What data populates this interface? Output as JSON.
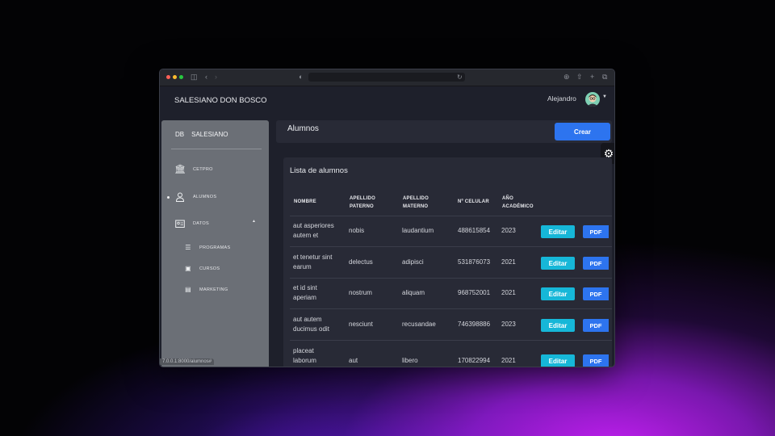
{
  "colors": {
    "accent_blue": "#2d74ef",
    "accent_cyan": "#16b7d8",
    "sidebar_bg": "#6b6f76",
    "card_bg": "#282a36",
    "window_bg": "#1e202b"
  },
  "browser": {
    "url": "",
    "icons": [
      "sidebar-toggle-icon",
      "back-icon",
      "forward-icon",
      "shield-icon",
      "reload-icon",
      "download-icon",
      "share-icon",
      "new-tab-icon",
      "tabs-icon"
    ]
  },
  "topbar": {
    "brand": "SALESIANO DON BOSCO",
    "user_name": "Alejandro"
  },
  "sidebar": {
    "brand_short": "DB",
    "brand_name": "SALESIANO",
    "items": [
      {
        "label": "CETPRO",
        "icon": "bank-icon"
      },
      {
        "label": "ALUMNOS",
        "icon": "user-icon"
      },
      {
        "label": "DATOS",
        "icon": "id-card-icon"
      }
    ],
    "sub_items": [
      {
        "label": "PROGRAMAS",
        "icon": "list-icon"
      },
      {
        "label": "CURSOS",
        "icon": "book-icon"
      },
      {
        "label": "MARKETING",
        "icon": "document-icon"
      }
    ]
  },
  "status_url": "7.0.0.1:8000/alumnos#",
  "page": {
    "title": "Alumnos",
    "create_label": "Crear"
  },
  "list": {
    "title": "Lista de alumnos",
    "headers": {
      "nombre": "NOMBRE",
      "paterno_1": "APELLIDO",
      "paterno_2": "PATERNO",
      "materno_1": "APELLIDO",
      "materno_2": "MATERNO",
      "celular": "Nº CELULAR",
      "anio_1": "AÑO",
      "anio_2": "ACADÉMICO"
    },
    "edit_label": "Editar",
    "pdf_label": "PDF",
    "rows": [
      {
        "nombre_1": "aut asperiores",
        "nombre_2": "autem et",
        "paterno": "nobis",
        "materno": "laudantium",
        "celular": "488615854",
        "anio": "2023"
      },
      {
        "nombre_1": "et tenetur sint",
        "nombre_2": "earum",
        "paterno": "delectus",
        "materno": "adipisci",
        "celular": "531876073",
        "anio": "2021"
      },
      {
        "nombre_1": "et id sint",
        "nombre_2": "aperiam",
        "paterno": "nostrum",
        "materno": "aliquam",
        "celular": "968752001",
        "anio": "2021"
      },
      {
        "nombre_1": "aut autem",
        "nombre_2": "ducimus odit",
        "paterno": "nesciunt",
        "materno": "recusandae",
        "celular": "746398886",
        "anio": "2023"
      },
      {
        "nombre_1": "placeat",
        "nombre_2": "laborum",
        "paterno": "aut",
        "materno": "libero",
        "celular": "170822994",
        "anio": "2021"
      }
    ]
  }
}
